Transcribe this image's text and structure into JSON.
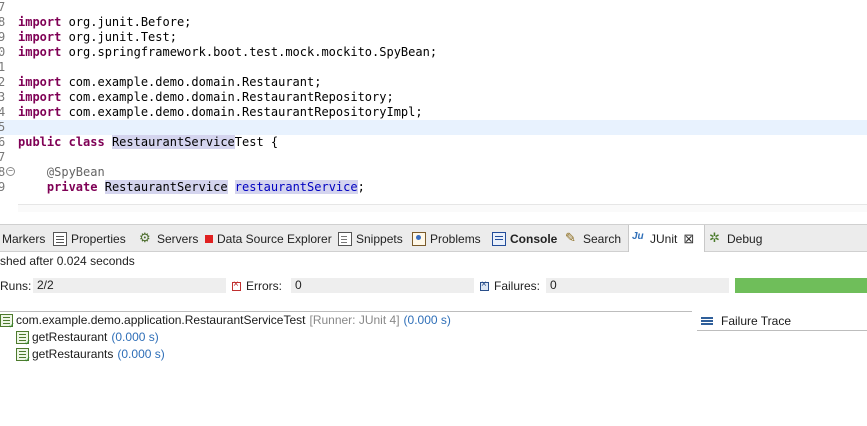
{
  "editor": {
    "lines": [
      {
        "n": "7",
        "text": ""
      },
      {
        "n": "8",
        "parts": [
          {
            "t": "import",
            "k": "kw"
          },
          {
            "t": " org.junit.Before;"
          }
        ]
      },
      {
        "n": "9",
        "parts": [
          {
            "t": "import",
            "k": "kw"
          },
          {
            "t": " org.junit.Test;"
          }
        ]
      },
      {
        "n": "0",
        "parts": [
          {
            "t": "import",
            "k": "kw"
          },
          {
            "t": " org.springframework.boot.test.mock.mockito.SpyBean;"
          }
        ]
      },
      {
        "n": "1",
        "text": ""
      },
      {
        "n": "2",
        "parts": [
          {
            "t": "import",
            "k": "kw"
          },
          {
            "t": " com.example.demo.domain.Restaurant;"
          }
        ]
      },
      {
        "n": "3",
        "parts": [
          {
            "t": "import",
            "k": "kw"
          },
          {
            "t": " com.example.demo.domain.RestaurantRepository;"
          }
        ]
      },
      {
        "n": "4",
        "parts": [
          {
            "t": "import",
            "k": "kw"
          },
          {
            "t": " com.example.demo.domain.RestaurantRepositoryImpl;"
          }
        ]
      },
      {
        "n": "5",
        "text": "",
        "current": true
      },
      {
        "n": "6",
        "parts": [
          {
            "t": "public",
            "k": "kw"
          },
          {
            "t": " "
          },
          {
            "t": "class",
            "k": "kw"
          },
          {
            "t": " "
          },
          {
            "t": "RestaurantService",
            "k": "hl"
          },
          {
            "t": "Test {"
          }
        ]
      },
      {
        "n": "7",
        "text": ""
      },
      {
        "n": "8",
        "fold": true,
        "parts": [
          {
            "t": "    "
          },
          {
            "t": "@SpyBean",
            "k": "ann"
          }
        ]
      },
      {
        "n": "9",
        "parts": [
          {
            "t": "    "
          },
          {
            "t": "private",
            "k": "kw"
          },
          {
            "t": " "
          },
          {
            "t": "RestaurantService",
            "k": "hl"
          },
          {
            "t": " "
          },
          {
            "t": "restaurantService",
            "k": "field hl"
          },
          {
            "t": ";"
          }
        ]
      }
    ]
  },
  "tabs": [
    {
      "id": "markers",
      "label": "Markers",
      "icon": "markers-icon"
    },
    {
      "id": "properties",
      "label": "Properties",
      "icon": "properties-icon"
    },
    {
      "id": "servers",
      "label": "Servers",
      "icon": "servers-icon"
    },
    {
      "id": "data-source-explorer",
      "label": "Data Source Explorer",
      "icon": "data-source-icon"
    },
    {
      "id": "snippets",
      "label": "Snippets",
      "icon": "snippets-icon"
    },
    {
      "id": "problems",
      "label": "Problems",
      "icon": "problems-icon"
    },
    {
      "id": "console",
      "label": "Console",
      "icon": "console-icon"
    },
    {
      "id": "search",
      "label": "Search",
      "icon": "search-icon"
    },
    {
      "id": "junit",
      "label": "JUnit",
      "icon": "junit-icon",
      "active": true,
      "close": "⊠"
    },
    {
      "id": "debug",
      "label": "Debug",
      "icon": "debug-icon"
    }
  ],
  "junit": {
    "status": "shed after 0.024 seconds",
    "runs_label": "Runs:",
    "runs_value": "2/2",
    "errors_label": "Errors:",
    "errors_value": "0",
    "failures_label": "Failures:",
    "failures_value": "0",
    "progress_fraction": 1.0,
    "progress_color": "#6fbe5a",
    "failure_trace_label": "Failure Trace",
    "tree": [
      {
        "name": "com.example.demo.application.RestaurantServiceTest",
        "runner": "[Runner: JUnit 4]",
        "time": "(0.000 s)",
        "level": 0
      },
      {
        "name": "getRestaurant",
        "time": "(0.000 s)",
        "level": 1
      },
      {
        "name": "getRestaurants",
        "time": "(0.000 s)",
        "level": 1
      }
    ]
  }
}
